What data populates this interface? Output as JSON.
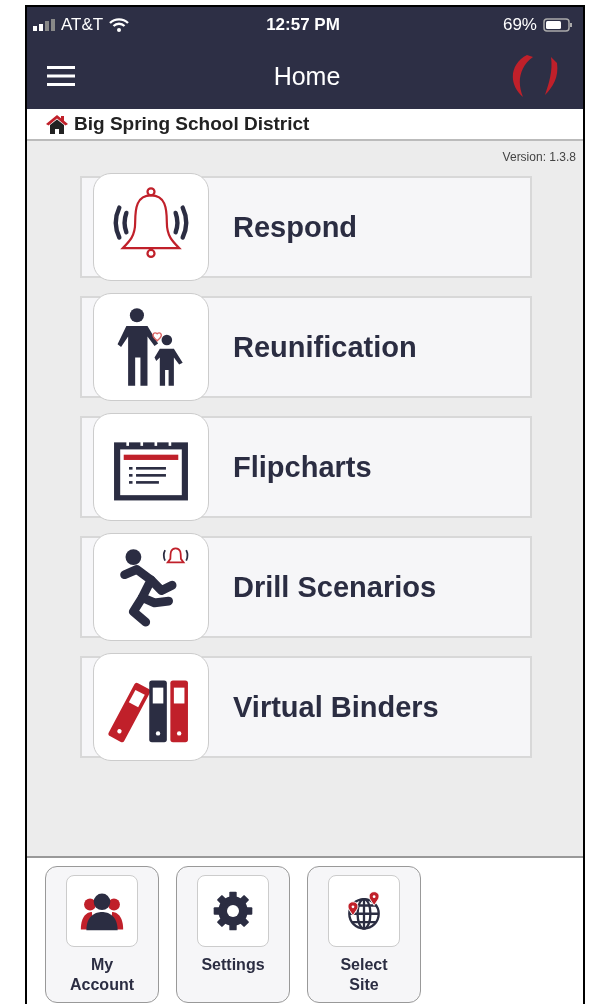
{
  "status_bar": {
    "carrier": "AT&T",
    "time": "12:57 PM",
    "battery": "69%"
  },
  "nav_bar": {
    "title": "Home"
  },
  "district": {
    "name": "Big Spring School District"
  },
  "version": "Version: 1.3.8",
  "menu_items": [
    {
      "kind": "respond",
      "label": "Respond"
    },
    {
      "kind": "reunification",
      "label": "Reunification"
    },
    {
      "kind": "flipcharts",
      "label": "Flipcharts"
    },
    {
      "kind": "drill",
      "label": "Drill Scenarios"
    },
    {
      "kind": "binders",
      "label": "Virtual Binders"
    }
  ],
  "toolbar": [
    {
      "kind": "account",
      "label": "My\nAccount"
    },
    {
      "kind": "settings",
      "label": "Settings"
    },
    {
      "kind": "site",
      "label": "Select\nSite"
    }
  ]
}
